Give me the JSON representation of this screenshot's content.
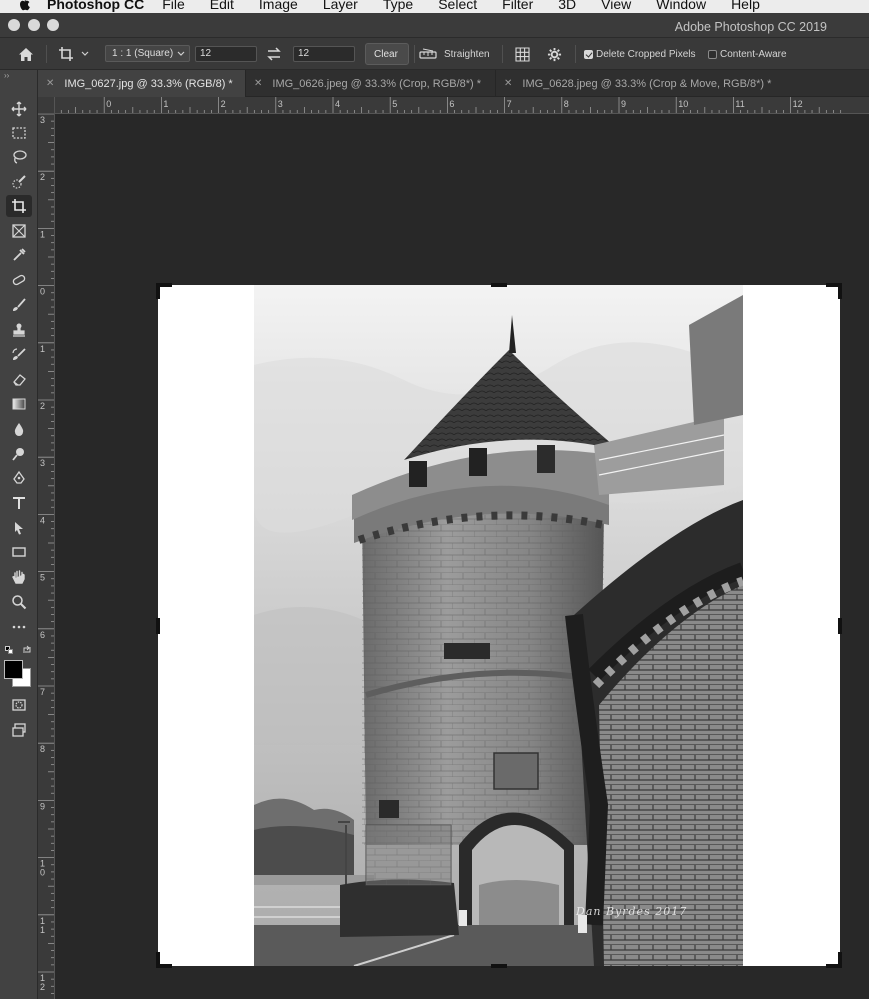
{
  "menubar": {
    "app_name": "Photoshop CC",
    "items": [
      "File",
      "Edit",
      "Image",
      "Layer",
      "Type",
      "Select",
      "Filter",
      "3D",
      "View",
      "Window",
      "Help"
    ]
  },
  "window": {
    "title": "Adobe Photoshop CC 2019"
  },
  "options_bar": {
    "ratio_preset": "1 : 1 (Square)",
    "width_value": "12",
    "height_value": "12",
    "clear_label": "Clear",
    "straighten_label": "Straighten",
    "delete_cropped_label": "Delete Cropped Pixels",
    "delete_cropped_checked": true,
    "content_aware_label": "Content-Aware",
    "content_aware_checked": false
  },
  "tabs": [
    {
      "label": "IMG_0627.jpg @ 33.3% (RGB/8) *",
      "active": true
    },
    {
      "label": "IMG_0626.jpeg @ 33.3% (Crop, RGB/8*) *",
      "active": false
    },
    {
      "label": "IMG_0628.jpeg @ 33.3% (Crop & Move, RGB/8*) *",
      "active": false
    }
  ],
  "rulers": {
    "top_labels": [
      "1",
      "0",
      "1",
      "2",
      "3",
      "4",
      "5",
      "6",
      "7",
      "8",
      "9",
      "10",
      "11",
      "12"
    ],
    "left_labels": [
      "3",
      "2",
      "1",
      "0",
      "1",
      "2",
      "3",
      "4",
      "5",
      "6",
      "7",
      "8",
      "9",
      "10",
      "11",
      "12"
    ]
  },
  "tools": [
    "move-tool",
    "marquee-tool",
    "lasso-tool",
    "quick-select-tool",
    "crop-tool",
    "frame-tool",
    "eyedropper-tool",
    "healing-brush-tool",
    "brush-tool",
    "clone-stamp-tool",
    "history-brush-tool",
    "eraser-tool",
    "gradient-tool",
    "blur-tool",
    "dodge-tool",
    "pen-tool",
    "type-tool",
    "path-select-tool",
    "rectangle-tool",
    "hand-tool",
    "zoom-tool",
    "edit-toolbar",
    "default-colors",
    "swap-colors",
    "foreground-color",
    "quick-mask",
    "screen-mode"
  ],
  "colors": {
    "foreground": "#000000",
    "background": "#ffffff"
  },
  "image": {
    "watermark": "Dan Byrdes 2017"
  }
}
